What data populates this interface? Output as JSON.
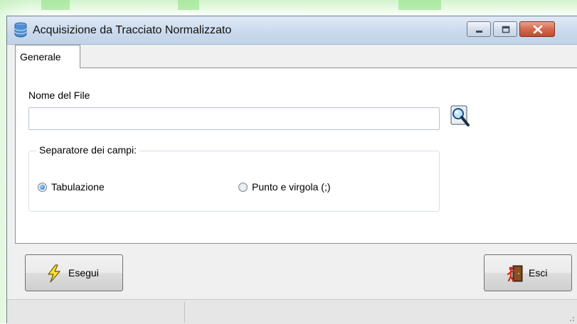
{
  "window": {
    "title": "Acquisizione da Tracciato Normalizzato",
    "icon": "database-icon"
  },
  "tabs": [
    {
      "label": "Generale",
      "active": true
    }
  ],
  "form": {
    "file_label": "Nome del File",
    "file_value": "",
    "browse_icon": "magnifier-icon",
    "separator_group": {
      "legend": "Separatore dei campi:",
      "options": [
        {
          "label": "Tabulazione",
          "checked": true
        },
        {
          "label": "Punto e virgola (;)",
          "checked": false
        }
      ]
    }
  },
  "buttons": {
    "execute": {
      "label": "Esegui",
      "icon": "lightning-icon"
    },
    "exit": {
      "label": "Esci",
      "icon": "exit-door-icon"
    }
  },
  "colors": {
    "titlebar": "#c9d9ec",
    "close_button": "#d46a4f",
    "radio_checked": "#1a6cc7"
  }
}
